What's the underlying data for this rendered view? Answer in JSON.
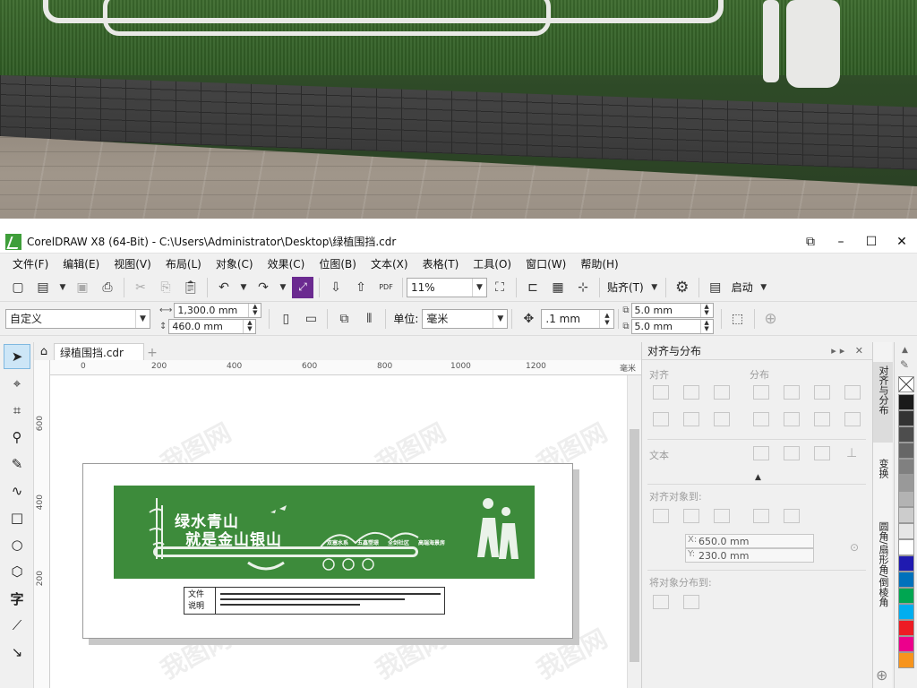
{
  "window": {
    "title": "CorelDRAW X8 (64-Bit) - C:\\Users\\Administrator\\Desktop\\绿植围挡.cdr"
  },
  "menu": [
    "文件(F)",
    "编辑(E)",
    "视图(V)",
    "布局(L)",
    "对象(C)",
    "效果(C)",
    "位图(B)",
    "文本(X)",
    "表格(T)",
    "工具(O)",
    "窗口(W)",
    "帮助(H)"
  ],
  "standard_toolbar": {
    "zoom": "11%",
    "snap_label": "贴齐(T)",
    "launch_label": "启动",
    "pdf_label": "PDF"
  },
  "property_bar": {
    "page_preset": "自定义",
    "width": "1,300.0 mm",
    "height": "460.0 mm",
    "units_label": "单位:",
    "units_value": "毫米",
    "nudge": ".1 mm",
    "dup_x": "5.0 mm",
    "dup_y": "5.0 mm"
  },
  "document": {
    "tab_name": "绿植围挡.cdr",
    "ruler_unit": "毫米",
    "h_ticks": [
      "0",
      "200",
      "400",
      "600",
      "800",
      "1000",
      "1200"
    ],
    "v_ticks": [
      "600",
      "400",
      "200"
    ]
  },
  "artwork": {
    "line1": "绿水青山",
    "line2": "就是金山银山",
    "tags": [
      "双塞水系",
      "五鑫塑璟",
      "全剑社区",
      "高端海景房"
    ],
    "note_label": "文件\n说明"
  },
  "docker": {
    "title": "对齐与分布",
    "align_label": "对齐",
    "distribute_label": "分布",
    "text_label": "文本",
    "align_to_label": "对齐对象到:",
    "x_value": "650.0 mm",
    "y_value": "230.0 mm",
    "distribute_to_label": "将对象分布到:",
    "x_axis": "X:",
    "y_axis": "Y:"
  },
  "side_tabs": [
    "对齐与分布",
    "变换",
    "圆角/扇形角/倒棱角"
  ],
  "palette": [
    "#ffffff",
    "#1a1a1a",
    "#333333",
    "#4d4d4d",
    "#666666",
    "#808080",
    "#999999",
    "#b3b3b3",
    "#cccccc",
    "#e6e6e6",
    "#ffffff",
    "#1f1ab0",
    "#0071bc",
    "#00a651",
    "#00aeef",
    "#ed1c24",
    "#ec008c",
    "#f7941d"
  ]
}
